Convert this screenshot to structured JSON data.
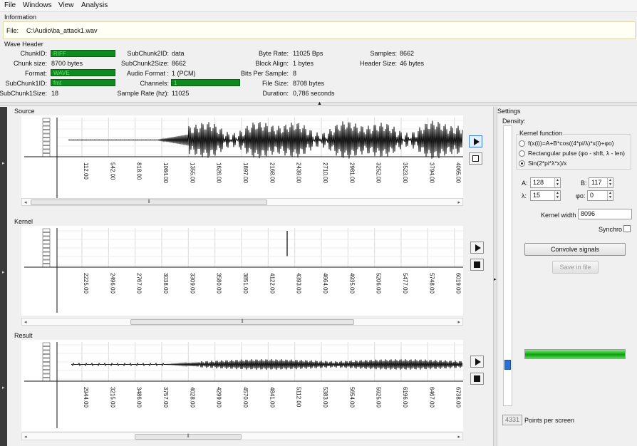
{
  "menu": [
    "File",
    "Windows",
    "View",
    "Analysis"
  ],
  "information": {
    "title": "Information",
    "file_label": "File:",
    "file_path": "C:\\Audio\\ba_attack1.wav"
  },
  "wave_header": {
    "title": "Wave Header",
    "chunk_id": {
      "label": "ChunkID:",
      "value": "RIFF"
    },
    "chunk_size": {
      "label": "Chunk size:",
      "value": "8700 bytes"
    },
    "format": {
      "label": "Format:",
      "value": "WAVE"
    },
    "subchunk1_id": {
      "label": "SubChunk1ID:",
      "value": "fmt"
    },
    "subchunk1_size": {
      "label": "SubChunk1Size:",
      "value": "18"
    },
    "subchunk2_id": {
      "label": "SubChunk2ID:",
      "value": "data"
    },
    "subchunk2_size": {
      "label": "SubChunk2Size:",
      "value": "8662"
    },
    "audio_format": {
      "label": "Audio Format :",
      "value": "1 (PCM)"
    },
    "channels": {
      "label": "Channels:",
      "value": "1"
    },
    "sample_rate": {
      "label": "Sample Rate (hz):",
      "value": "11025"
    },
    "byte_rate": {
      "label": "Byte Rate:",
      "value": "11025 Bps"
    },
    "block_align": {
      "label": "Block Align:",
      "value": "1 bytes"
    },
    "bits_per_sample": {
      "label": "Bits Per Sample:",
      "value": "8"
    },
    "file_size": {
      "label": "File Size:",
      "value": "8708 bytes"
    },
    "duration": {
      "label": "Duration:",
      "value": "0,786 seconds"
    },
    "samples": {
      "label": "Samples:",
      "value": "8662"
    },
    "header_size": {
      "label": "Header Size:",
      "value": "46 bytes"
    }
  },
  "panels": {
    "source": {
      "title": "Source",
      "x_ticks": [
        "112.00",
        "542.00",
        "818.00",
        "1084.00",
        "1355.00",
        "1626.00",
        "1897.00",
        "2168.00",
        "2439.00",
        "2710.00",
        "2981.00",
        "3252.00",
        "3523.00",
        "3794.00",
        "4065.00"
      ]
    },
    "kernel": {
      "title": "Kernel",
      "x_ticks": [
        "2225.00",
        "2496.00",
        "2767.00",
        "3038.00",
        "3309.00",
        "3580.00",
        "3851.00",
        "4122.00",
        "4393.00",
        "4664.00",
        "4935.00",
        "5206.00",
        "5477.00",
        "5748.00",
        "6019.00"
      ]
    },
    "result": {
      "title": "Result",
      "x_ticks": [
        "2944.00",
        "3215.00",
        "3486.00",
        "3757.00",
        "4028.00",
        "4299.00",
        "4570.00",
        "4841.00",
        "5112.00",
        "5383.00",
        "5654.00",
        "5925.00",
        "6196.00",
        "6467.00",
        "6738.00"
      ]
    }
  },
  "settings": {
    "title": "Settings",
    "density_label": "Density:",
    "kernel_function_title": "Kernel function",
    "options": [
      {
        "label": "f(x(i))=A+B*cos((4*pi/λ)*x(i)+φo)",
        "selected": false
      },
      {
        "label": "Rectangular pulse (φo - shft, λ - len)",
        "selected": false
      },
      {
        "label": "Sin(2*pi*λ*x)/x",
        "selected": true
      }
    ],
    "a_label": "A:",
    "a_value": "128",
    "b_label": "B:",
    "b_value": "117",
    "lambda_label": "λ:",
    "lambda_value": "15",
    "phi_label": "φo:",
    "phi_value": "0",
    "kernel_width_label": "Kernel width",
    "kernel_width_value": "8096",
    "synchro_label": "Synchro",
    "convolve_label": "Convolve signals",
    "save_label": "Save in file",
    "points_value": "4331",
    "points_label": "Points per screen",
    "progress": 1.0,
    "density_slider": 0.1
  }
}
